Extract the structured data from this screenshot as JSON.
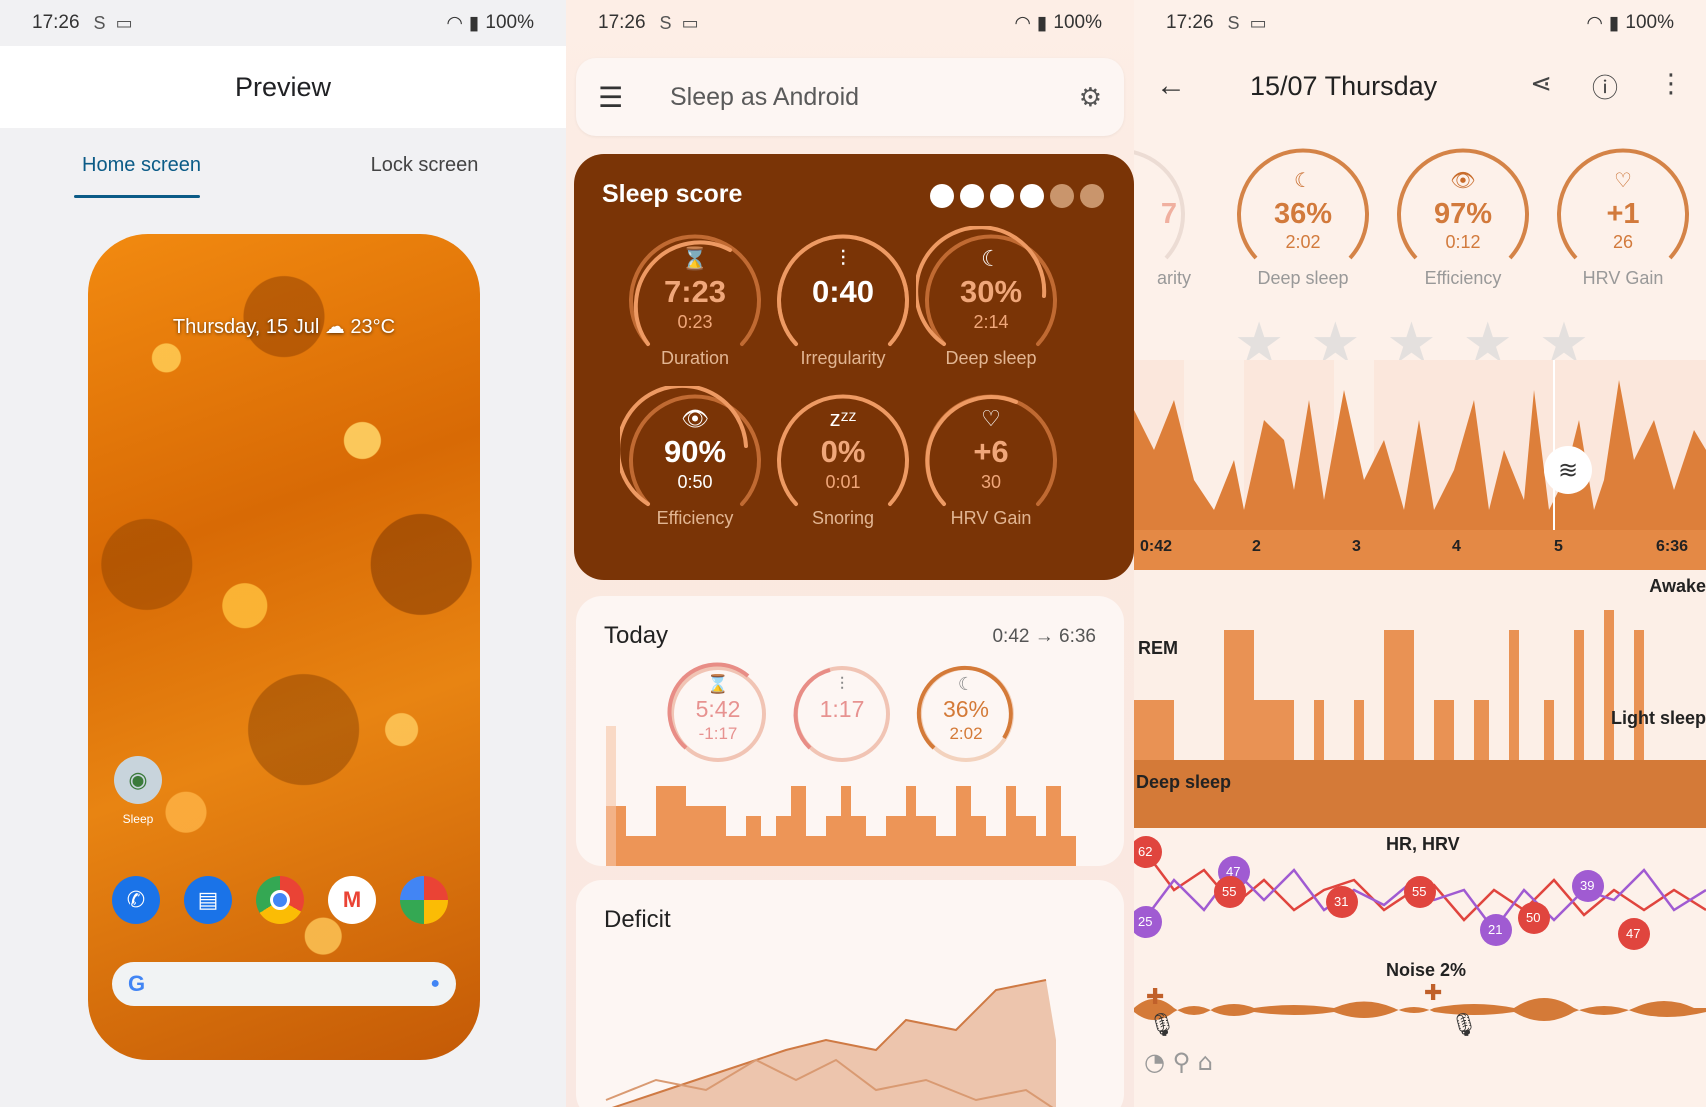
{
  "status": {
    "time": "17:26",
    "battery": "100%"
  },
  "preview": {
    "title": "Preview",
    "tabs": [
      "Home screen",
      "Lock screen"
    ],
    "phone_date": "Thursday, 15 Jul",
    "phone_weather": "23°C",
    "app_label": "Sleep"
  },
  "sleep_app": {
    "title": "Sleep as Android",
    "score_title": "Sleep score",
    "score_dots": {
      "filled": 4,
      "total": 6
    },
    "gauges": [
      {
        "icon": "⌛",
        "value": "7:23",
        "sub": "0:23",
        "label": "Duration"
      },
      {
        "icon": "⫶",
        "value": "0:40",
        "sub": "",
        "label": "Irregularity"
      },
      {
        "icon": "☾",
        "value": "30%",
        "sub": "2:14",
        "label": "Deep sleep"
      },
      {
        "icon": "👁",
        "value": "90%",
        "sub": "0:50",
        "label": "Efficiency"
      },
      {
        "icon": "zᶻᶻ",
        "value": "0%",
        "sub": "0:01",
        "label": "Snoring"
      },
      {
        "icon": "♡",
        "value": "+6",
        "sub": "30",
        "label": "HRV Gain"
      }
    ],
    "today": {
      "title": "Today",
      "time_range": "0:42 → 6:36",
      "gauges": [
        {
          "icon": "⌛",
          "value": "5:42",
          "sub": "-1:17"
        },
        {
          "icon": "⫶",
          "value": "1:17",
          "sub": ""
        },
        {
          "icon": "☾",
          "value": "36%",
          "sub": "2:02"
        }
      ]
    },
    "deficit_title": "Deficit"
  },
  "detail": {
    "title": "15/07 Thursday",
    "gauges": [
      {
        "value": "7",
        "label": "arity"
      },
      {
        "icon": "☾",
        "value": "36%",
        "sub": "2:02",
        "label": "Deep sleep"
      },
      {
        "icon": "👁",
        "value": "97%",
        "sub": "0:12",
        "label": "Efficiency"
      },
      {
        "icon": "♡",
        "value": "+1",
        "sub": "26",
        "label": "HRV Gain"
      }
    ],
    "graph_ticks": [
      "0:42",
      "2",
      "3",
      "4",
      "5",
      "6:36"
    ],
    "hypnogram_labels": [
      "Awake",
      "REM",
      "Light sleep",
      "Deep sleep"
    ],
    "hr_title": "HR, HRV",
    "hr_markers": [
      "62",
      "47",
      "55",
      "25",
      "31",
      "55",
      "21",
      "50",
      "39",
      "47"
    ],
    "noise_title": "Noise 2%"
  }
}
